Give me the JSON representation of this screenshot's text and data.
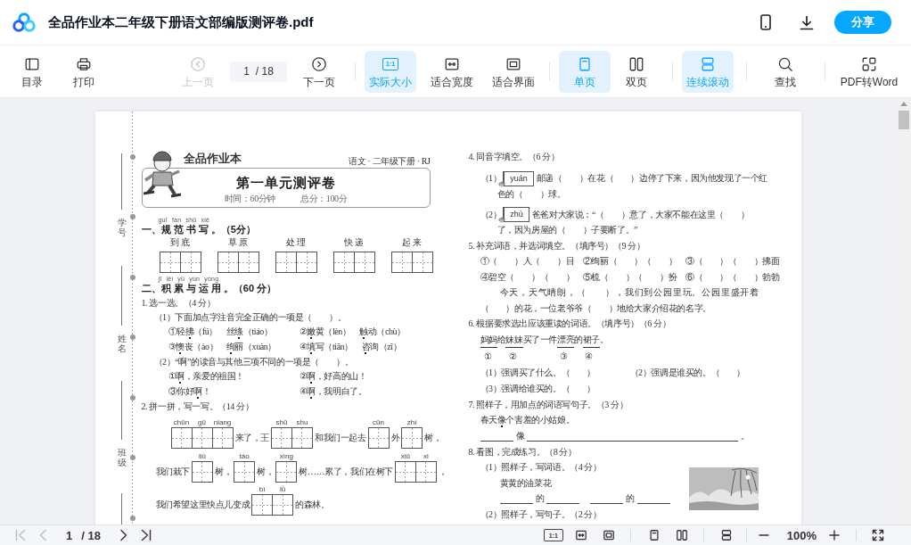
{
  "header": {
    "title": "全品作业本二年级下册语文部编版测评卷.pdf",
    "share": "分享"
  },
  "toolbar": {
    "groups": [
      [
        {
          "kind": "contents",
          "label": "目录",
          "selected": false,
          "disabled": false
        },
        {
          "kind": "print",
          "label": "打印",
          "selected": false,
          "disabled": false
        }
      ],
      [
        {
          "kind": "previous",
          "label": "上一页",
          "selected": false,
          "disabled": true
        },
        {
          "kind": "pager",
          "value": "1",
          "total": "/ 18"
        },
        {
          "kind": "next",
          "label": "下一页",
          "selected": false,
          "disabled": false
        }
      ],
      [
        {
          "kind": "actual",
          "label": "实际大小",
          "badge": "1:1",
          "selected": true,
          "disabled": false
        },
        {
          "kind": "width",
          "label": "适合宽度",
          "selected": false,
          "disabled": false
        },
        {
          "kind": "fit",
          "label": "适合界面",
          "selected": false,
          "disabled": false
        }
      ],
      [
        {
          "kind": "single",
          "label": "单页",
          "selected": true,
          "disabled": false
        },
        {
          "kind": "double",
          "label": "双页",
          "selected": false,
          "disabled": false
        }
      ],
      [
        {
          "kind": "continuous",
          "label": "连续滚动",
          "selected": true,
          "disabled": false
        }
      ],
      [
        {
          "kind": "search",
          "label": "查找",
          "selected": false,
          "disabled": false
        }
      ],
      [
        {
          "kind": "convert",
          "label": "PDF转Word",
          "selected": false,
          "disabled": false
        }
      ]
    ]
  },
  "document": {
    "margin_labels": [
      "学号",
      "姓名",
      "班级"
    ],
    "brand": "全品作业本",
    "subject": "语文 · 二年级下册 · RJ",
    "title": "第一单元测评卷",
    "time": "时间：60分钟",
    "total": "总分：100分",
    "left": [
      {
        "kind": "section",
        "pinyin": "guī fàn shū xiě",
        "text": "一、规 范 书 写 。（5分）"
      },
      {
        "kind": "copy",
        "words": [
          "到底",
          "草原",
          "处理",
          "快递",
          "起来"
        ]
      },
      {
        "kind": "section",
        "pinyin": "jī lěi yǔ yùn yòng",
        "text": "二、积 累 与 运 用 。（60 分）"
      },
      {
        "kind": "text",
        "text": "1. 选一选。（4 分）",
        "children": [
          {
            "kind": "text",
            "text": "（1）下面加点字注音完全正确的一项是（　　）。",
            "children": [
              {
                "kind": "options",
                "cells": [
                  [
                    {
                      "text": "①轻",
                      "dotted": false
                    },
                    {
                      "text": "拂",
                      "dotted": true
                    },
                    {
                      "text": "（fú）　丝",
                      "dotted": false
                    },
                    {
                      "text": "绦",
                      "dotted": true
                    },
                    {
                      "text": "（tiáo）",
                      "dotted": false
                    }
                  ],
                  [
                    {
                      "text": "②",
                      "dotted": false
                    },
                    {
                      "text": "嫩",
                      "dotted": true
                    },
                    {
                      "text": "黄（lèn）　",
                      "dotted": false
                    },
                    {
                      "text": "触",
                      "dotted": true
                    },
                    {
                      "text": "动（chù）",
                      "dotted": false
                    }
                  ]
                ]
              },
              {
                "kind": "options",
                "cells": [
                  [
                    {
                      "text": "③",
                      "dotted": false
                    },
                    {
                      "text": "懊",
                      "dotted": true
                    },
                    {
                      "text": "丧（ào）　",
                      "dotted": false
                    },
                    {
                      "text": "绚",
                      "dotted": true
                    },
                    {
                      "text": "丽（xuàn）",
                      "dotted": false
                    }
                  ],
                  [
                    {
                      "text": "④",
                      "dotted": false
                    },
                    {
                      "text": "填",
                      "dotted": true
                    },
                    {
                      "text": "写（tiān）　",
                      "dotted": false
                    },
                    {
                      "text": "咨",
                      "dotted": true
                    },
                    {
                      "text": "询（zī）",
                      "dotted": false
                    }
                  ]
                ]
              }
            ]
          },
          {
            "kind": "text",
            "text": "（2）“啊”的读音与其他三项不同的一项是（　　）。",
            "children": [
              {
                "kind": "options",
                "cells": [
                  [
                    {
                      "text": "①",
                      "dotted": false
                    },
                    {
                      "text": "啊",
                      "dotted": true
                    },
                    {
                      "text": "，亲爱的祖国！",
                      "dotted": false
                    }
                  ],
                  [
                    {
                      "text": "②",
                      "dotted": false
                    },
                    {
                      "text": "啊",
                      "dotted": true
                    },
                    {
                      "text": "，好高的山！",
                      "dotted": false
                    }
                  ]
                ]
              },
              {
                "kind": "options",
                "cells": [
                  [
                    {
                      "text": "③你好",
                      "dotted": false
                    },
                    {
                      "text": "啊",
                      "dotted": true
                    },
                    {
                      "text": "！",
                      "dotted": false
                    }
                  ],
                  [
                    {
                      "text": "④",
                      "dotted": false
                    },
                    {
                      "text": "啊",
                      "dotted": true
                    },
                    {
                      "text": "，我明白了。",
                      "dotted": false
                    }
                  ]
                ]
              }
            ]
          }
        ]
      },
      {
        "kind": "text",
        "text": "2. 拼一拼，写一写。（14 分）",
        "children": [
          {
            "kind": "fill",
            "parts": [
              {
                "kind": "boxes",
                "pinyin": [
                  "chūn",
                  "gū",
                  "niang"
                ]
              },
              {
                "kind": "text",
                "text": "来了，王"
              },
              {
                "kind": "boxes",
                "pinyin": [
                  "shū",
                  "shu"
                ]
              },
              {
                "kind": "text",
                "text": "和我们一起去"
              },
              {
                "kind": "boxes",
                "pinyin": [
                  "cūn"
                ]
              },
              {
                "kind": "text",
                "text": "外"
              },
              {
                "kind": "boxes",
                "pinyin": [
                  "zhí"
                ]
              },
              {
                "kind": "text",
                "text": "树，"
              }
            ]
          },
          {
            "kind": "fill",
            "parts": [
              {
                "kind": "text",
                "text": "我们栽下"
              },
              {
                "kind": "boxes",
                "pinyin": [
                  "liǔ"
                ]
              },
              {
                "kind": "text",
                "text": "树，"
              },
              {
                "kind": "boxes",
                "pinyin": [
                  "táo"
                ]
              },
              {
                "kind": "text",
                "text": "树，"
              },
              {
                "kind": "boxes",
                "pinyin": [
                  "xìng"
                ]
              },
              {
                "kind": "text",
                "text": "树……累了，我们在树下"
              },
              {
                "kind": "boxes",
                "pinyin": [
                  "xiū",
                  "xi"
                ]
              },
              {
                "kind": "text",
                "text": "，"
              }
            ]
          },
          {
            "kind": "fill",
            "parts": [
              {
                "kind": "text",
                "text": "我们希望这里快点儿变成"
              },
              {
                "kind": "boxes",
                "pinyin": [
                  "bì",
                  "lǜ"
                ]
              },
              {
                "kind": "text",
                "text": "的森林。"
              }
            ]
          }
        ]
      }
    ],
    "right": [
      {
        "kind": "text",
        "text": "4. 同音字填空。（6 分）",
        "children": [
          {
            "kind": "homophone",
            "label": "（1）",
            "pinyin": "yuán",
            "text": "邮递（　　）在花（　　）边停了下来，因为他发现了一个红",
            "continued": "色的（　　）球。"
          },
          {
            "kind": "homophone",
            "label": "（2）",
            "pinyin": "zhù",
            "text": "爸爸对大家说：“（　　）意了，大家不能在这里（　　）",
            "continued": "了，因为房屋的（　　）子要断了。”"
          }
        ]
      },
      {
        "kind": "text",
        "text": "5. 补充词语，并选词填空。（填序号）（9 分）",
        "children": [
          {
            "kind": "text",
            "text": "①（　　）人（　　）目　②绚丽（　　）（　　）　③（　　）（　　）拂面"
          },
          {
            "kind": "text",
            "text": "④碧空（　　）（　　）　⑤梳（　　）（　　）扮　⑥（　　）（　　）勃勃"
          },
          {
            "kind": "passage",
            "text": "今天，天气晴朗，（　　），我们到公园里玩。公园里盛开着"
          },
          {
            "kind": "text",
            "text": "（　　）的花，一位老爷爷（　　）地给大家介绍花的名字。"
          }
        ]
      },
      {
        "kind": "text",
        "text": "6. 根据要求选出应该重读的词语。（填序号）（6 分）",
        "children": [
          {
            "kind": "sentence",
            "segments": [
              {
                "text": "妈妈",
                "underlined": true
              },
              {
                "text": "给",
                "underlined": false
              },
              {
                "text": "妹妹",
                "underlined": true
              },
              {
                "text": "买了一件",
                "underlined": false
              },
              {
                "text": "漂亮",
                "underlined": true
              },
              {
                "text": "的",
                "underlined": false
              },
              {
                "text": "裙子",
                "underlined": true
              },
              {
                "text": "。",
                "underlined": false
              }
            ]
          },
          {
            "kind": "numbers",
            "labels": [
              "①",
              "②",
              "③",
              "④"
            ]
          },
          {
            "kind": "pair",
            "cells": [
              [
                {
                  "text": "（1）强调买了什么。（　　）",
                  "dotted": false
                }
              ],
              [
                {
                  "text": "（2）强调是谁买的。（　　）",
                  "dotted": false
                }
              ]
            ]
          },
          {
            "kind": "text",
            "text": "（3）强调给谁买的。（　　）"
          }
        ]
      },
      {
        "kind": "text",
        "text": "7. 照样子，用加点的词语写句子。（3 分）",
        "children": [
          {
            "kind": "sentence",
            "segments": [
              {
                "text": "春天",
                "dotted": false
              },
              {
                "text": "像",
                "dotted": true
              },
              {
                "text": "个害羞的小姑娘。",
                "dotted": false
              }
            ]
          },
          {
            "kind": "write",
            "parts": [
              {
                "kind": "blank"
              },
              {
                "kind": "text",
                "text": "像"
              },
              {
                "kind": "line"
              },
              {
                "kind": "text",
                "text": "。"
              }
            ]
          }
        ]
      },
      {
        "kind": "text",
        "text": "8. 看图，完成练习。（8 分）",
        "children": [
          {
            "kind": "picture"
          },
          {
            "kind": "text",
            "text": "（1）照样子，写词语。（4 分）",
            "children": [
              {
                "kind": "text",
                "text": "黄黄的油菜花"
              },
              {
                "kind": "write",
                "parts": [
                  {
                    "kind": "blank"
                  },
                  {
                    "kind": "text",
                    "text": "的"
                  },
                  {
                    "kind": "blank"
                  },
                  {
                    "kind": "gap"
                  },
                  {
                    "kind": "blank"
                  },
                  {
                    "kind": "text",
                    "text": "的"
                  },
                  {
                    "kind": "blank"
                  }
                ]
              }
            ]
          },
          {
            "kind": "text",
            "text": "（2）照样子，写句子。（2 分）"
          }
        ]
      }
    ]
  },
  "footer": {
    "first": {
      "disabled": true
    },
    "previous": {
      "disabled": true
    },
    "page": "1",
    "total": "/ 18",
    "next": {
      "disabled": false
    },
    "last": {
      "disabled": false
    },
    "views": [
      [
        {
          "kind": "actual",
          "badge": "1:1"
        },
        {
          "kind": "width"
        },
        {
          "kind": "fit"
        }
      ],
      [
        {
          "kind": "single"
        },
        {
          "kind": "double"
        }
      ],
      [
        {
          "kind": "continuous"
        }
      ]
    ],
    "zoom": "100%"
  }
}
